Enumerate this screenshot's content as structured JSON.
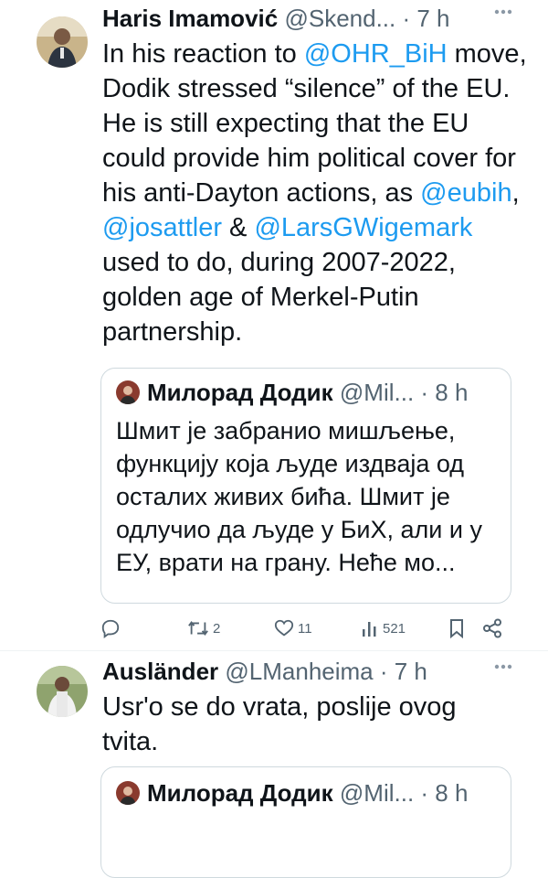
{
  "tweet1": {
    "name": "Haris Imamović",
    "handle": "@Skend...",
    "dot": " · ",
    "time": "7 h",
    "text_parts": [
      "In his reaction to ",
      "@OHR_BiH",
      " move, Dodik stressed “silence” of the EU. He is still expecting that the EU could provide him political cover for his anti-Dayton actions, as ",
      "@eubih",
      ", ",
      "@josattler",
      " & ",
      "@LarsGWigemark",
      " used to do, during 2007-2022, golden age of Merkel-Putin partnership."
    ],
    "quote": {
      "name": "Милорад Додик",
      "handle": "@Mil...",
      "dot": " · ",
      "time": "8 h",
      "text": "Шмит је забранио мишљење, функцију која људе издваја од осталих живих бића. Шмит је одлучио да људе у БиХ, али и у ЕУ, врати на грану. Неће мо..."
    },
    "actions": {
      "replies": "",
      "retweets": "2",
      "likes": "11",
      "views": "521"
    }
  },
  "tweet2": {
    "name": "Ausländer",
    "handle": "@LManheima",
    "dot": " · ",
    "time": "7 h",
    "text": "Usr'o se do vrata, poslije ovog tvita.",
    "quote": {
      "name": "Милорад Додик",
      "handle": "@Mil...",
      "dot": " · ",
      "time": "8 h"
    }
  },
  "colors": {
    "accent": "#1d9bf0",
    "secondary_text": "#536471",
    "border": "#cfd9de"
  },
  "icons": [
    "more-icon",
    "reply-icon",
    "retweet-icon",
    "like-icon",
    "views-icon",
    "bookmark-icon",
    "share-icon"
  ]
}
